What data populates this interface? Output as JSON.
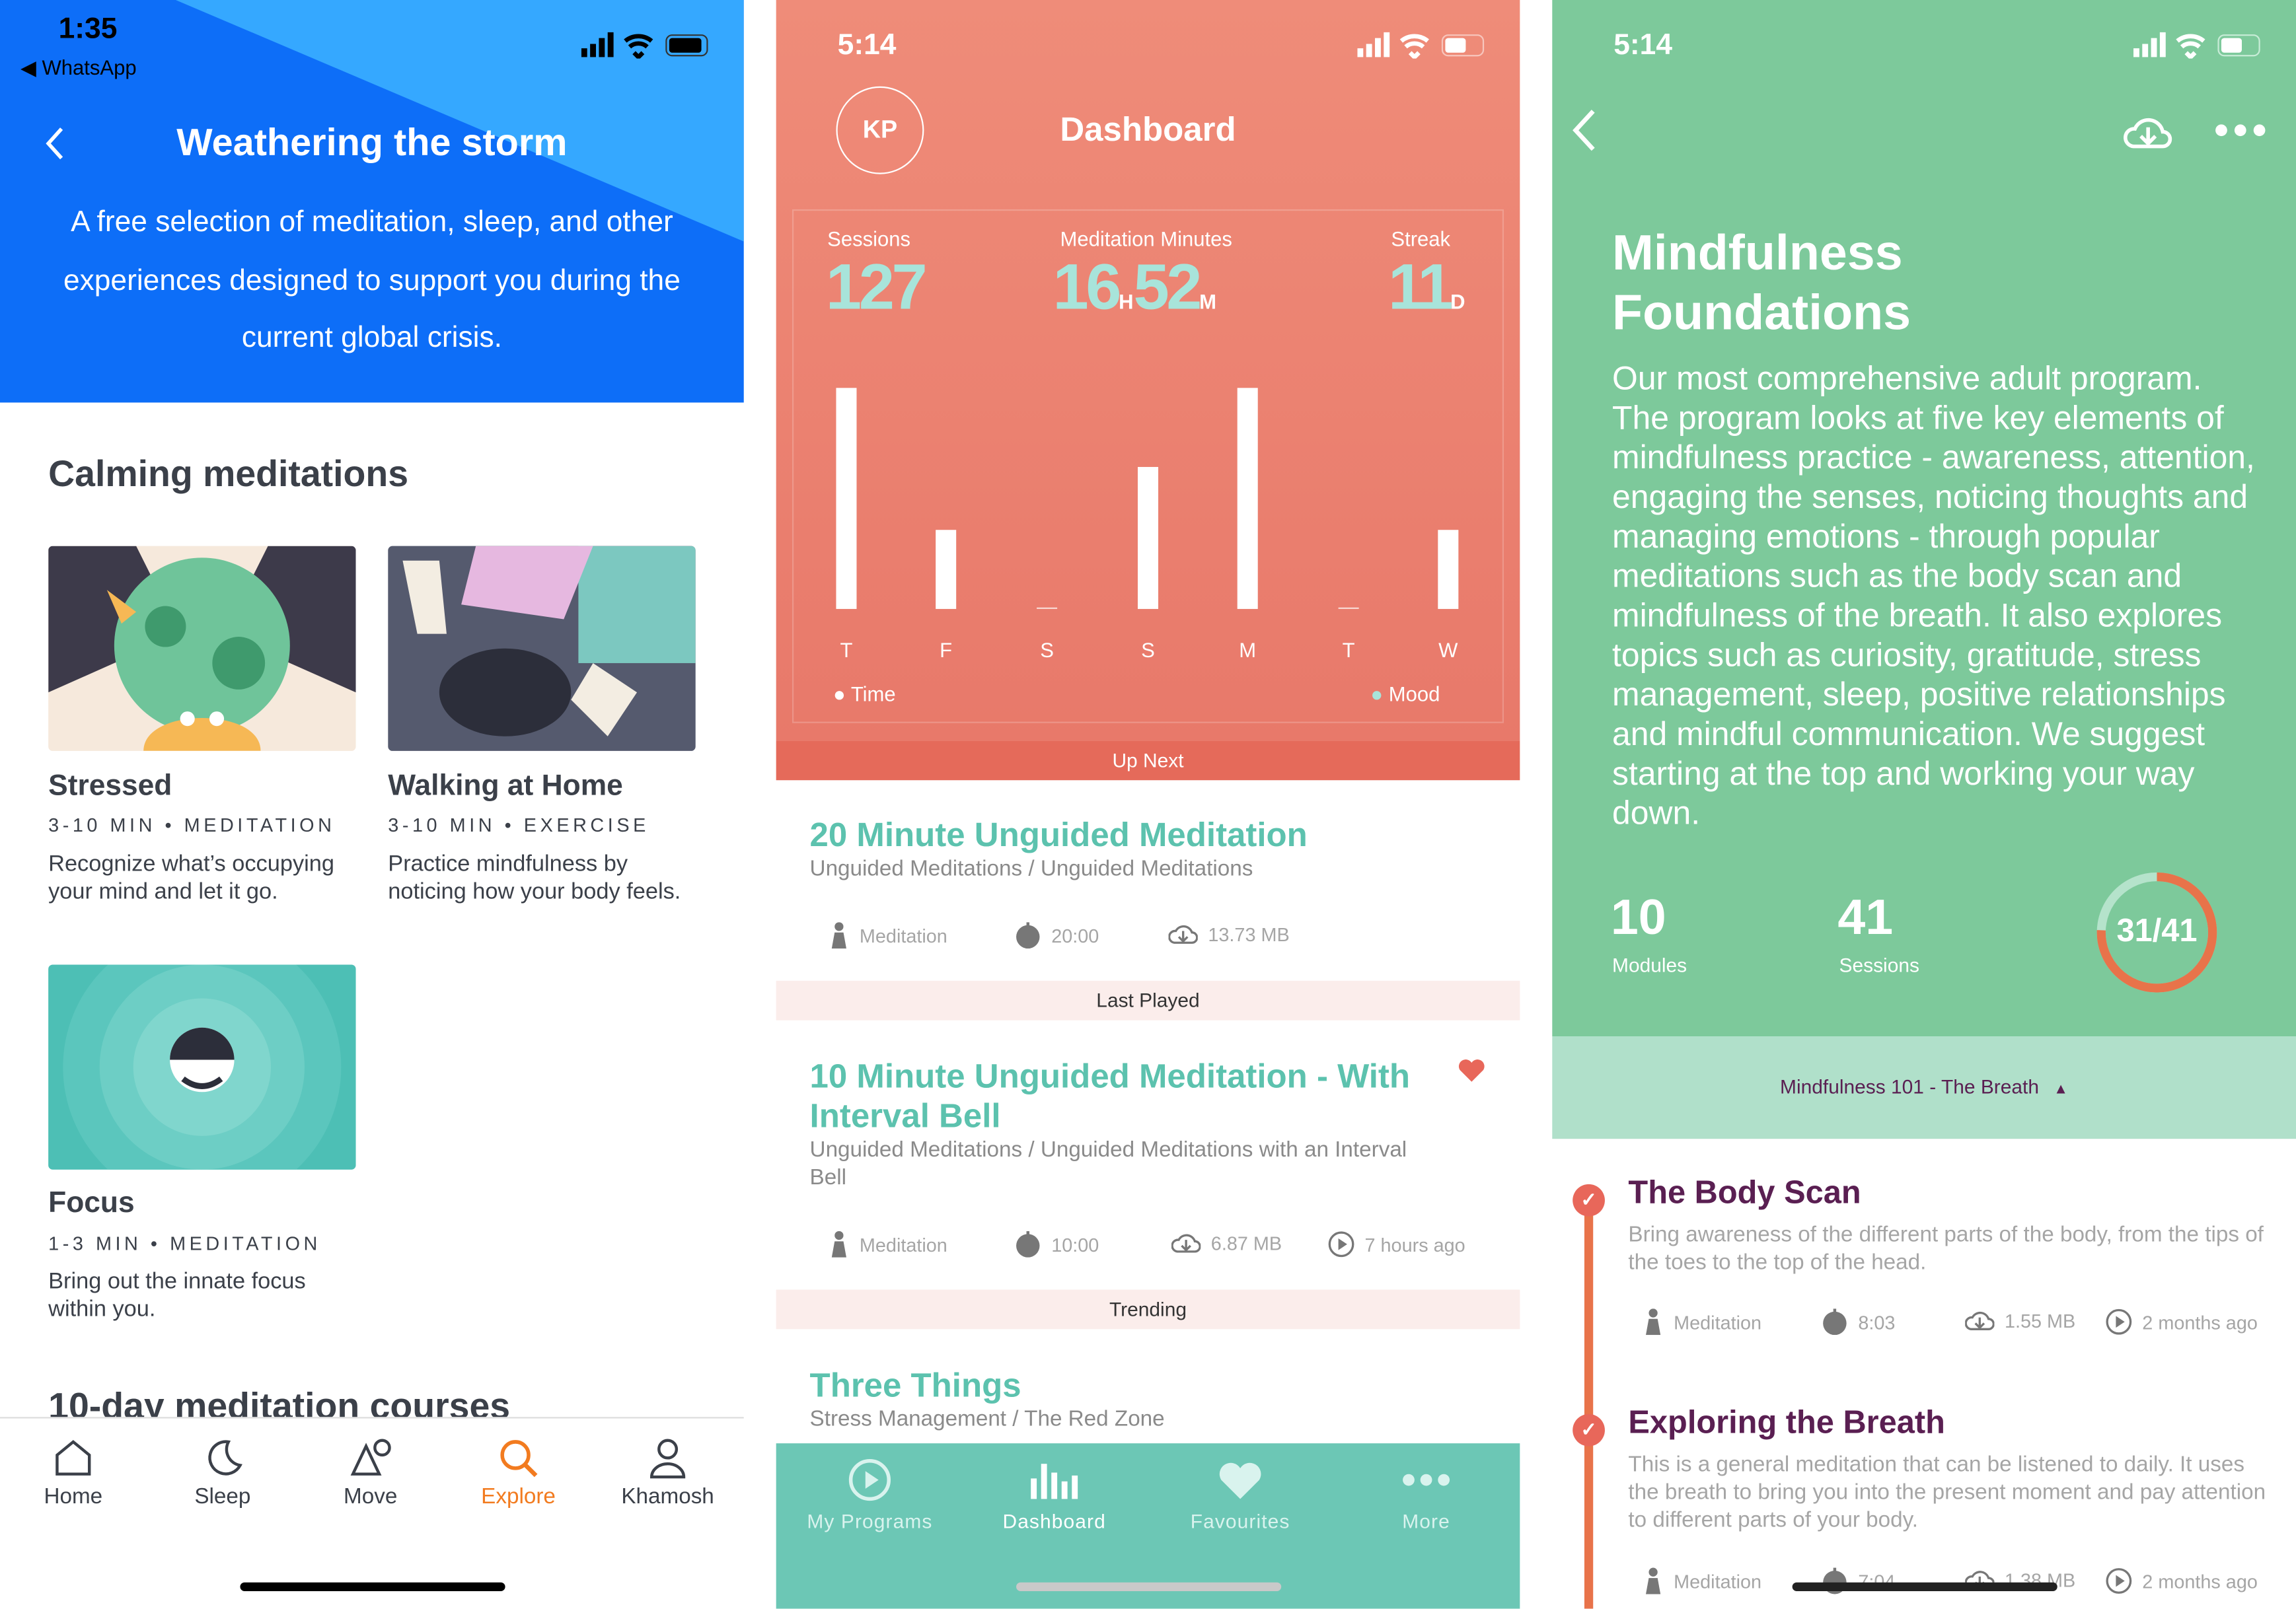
{
  "panel1": {
    "status": {
      "time": "1:35",
      "back_app": "WhatsApp"
    },
    "header": {
      "title": "Weathering the storm",
      "description": "A free selection of meditation, sleep, and other experiences designed to support you during the current global crisis."
    },
    "section_title": "Calming meditations",
    "cards": [
      {
        "title": "Stressed",
        "meta": "3-10 MIN • MEDITATION",
        "desc": "Recognize what’s occupying your mind and let it go."
      },
      {
        "title": "Walking at Home",
        "meta": "3-10 MIN • EXERCISE",
        "desc": "Practice mindfulness by noticing how your body feels."
      },
      {
        "title": "Focus",
        "meta": "1-3 MIN • MEDITATION",
        "desc": "Bring out the innate focus within you."
      }
    ],
    "next_section": "10-day meditation courses",
    "tabs": [
      {
        "label": "Home",
        "icon": "home-icon"
      },
      {
        "label": "Sleep",
        "icon": "moon-icon"
      },
      {
        "label": "Move",
        "icon": "shapes-icon"
      },
      {
        "label": "Explore",
        "icon": "search-icon",
        "active": true
      },
      {
        "label": "Khamosh",
        "icon": "person-icon"
      }
    ],
    "colors": {
      "header": "#0D6EF8",
      "header_light": "#35A8FF",
      "active_tab": "#F27B1F"
    }
  },
  "panel2": {
    "status": {
      "time": "5:14"
    },
    "avatar": "KP",
    "title": "Dashboard",
    "stats": {
      "sessions_label": "Sessions",
      "sessions": "127",
      "minutes_label": "Meditation Minutes",
      "hours": "16",
      "hours_unit": "H",
      "minutes": "52",
      "minutes_unit": "M",
      "streak_label": "Streak",
      "streak": "11",
      "streak_unit": "D"
    },
    "chart_data": {
      "type": "bar",
      "categories": [
        "T",
        "F",
        "S",
        "S",
        "M",
        "T",
        "W"
      ],
      "values": [
        1.0,
        0.36,
        0,
        0.64,
        1.0,
        0,
        0.36
      ],
      "legend": [
        "Time",
        "Mood"
      ],
      "colors": {
        "Time": "#ffffff",
        "Mood": "#A8E4DA"
      }
    },
    "sections": {
      "up_next": "Up Next",
      "last_played": "Last Played",
      "trending": "Trending"
    },
    "items": [
      {
        "title": "20 Minute Unguided Meditation",
        "sub": "Unguided Meditations / Unguided Meditations",
        "type": "Meditation",
        "duration": "20:00",
        "size": "13.73 MB"
      },
      {
        "title": "10 Minute Unguided Meditation - With Interval Bell",
        "sub": "Unguided Meditations / Unguided Meditations with an Interval Bell",
        "type": "Meditation",
        "duration": "10:00",
        "size": "6.87 MB",
        "played": "7 hours ago",
        "favourite": true
      },
      {
        "title": "Three Things",
        "sub": "Stress Management / The Red Zone"
      }
    ],
    "tabs": [
      {
        "label": "My Programs",
        "icon": "play-circle-icon"
      },
      {
        "label": "Dashboard",
        "icon": "bars-icon",
        "active": true
      },
      {
        "label": "Favourites",
        "icon": "heart-icon"
      },
      {
        "label": "More",
        "icon": "more-icon"
      }
    ],
    "colors": {
      "accent": "#5CC2AE",
      "header": "#EC8474",
      "tabbar": "#6CC7B5"
    }
  },
  "panel3": {
    "status": {
      "time": "5:14"
    },
    "title": "Mindfulness Foundations",
    "description": "Our most comprehensive adult program. The program looks at five key elements of mindfulness practice - awareness, attention, engaging the senses, noticing thoughts and managing emotions - through popular meditations such as the body scan and mindfulness of the breath. It also explores topics such as curiosity, gratitude, stress management, sleep, positive relationships and mindful communication. We suggest starting at the top and working your way down.",
    "stats": {
      "modules": "10",
      "modules_label": "Modules",
      "sessions": "41",
      "sessions_label": "Sessions",
      "progress": "31/41",
      "completed": 31,
      "total": 41
    },
    "module_selector": "Mindfulness 101 - The Breath",
    "lessons": [
      {
        "title": "The Body Scan",
        "desc": "Bring awareness of the different parts of the body, from the tips of the toes to the top of the head.",
        "type": "Meditation",
        "duration": "8:03",
        "size": "1.55 MB",
        "played": "2 months ago"
      },
      {
        "title": "Exploring the Breath",
        "desc": "This is a general meditation that can be listened to daily. It uses the breath to bring you into the present moment and pay attention to different parts of your body.",
        "type": "Meditation",
        "duration": "7:04",
        "size": "1.38 MB",
        "played": "2 months ago"
      }
    ],
    "colors": {
      "header": "#7DC99B",
      "band": "#B0E0CA",
      "title": "#5A1F52",
      "ring": "#E8734A"
    }
  }
}
